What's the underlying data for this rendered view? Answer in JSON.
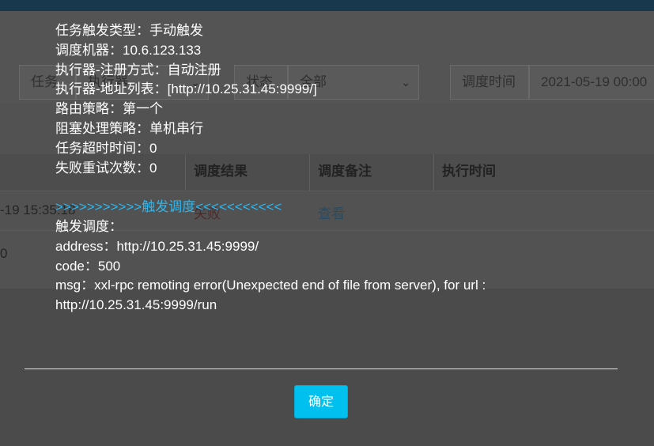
{
  "background": {
    "filters": {
      "task_label": "任务",
      "executor_value": "执行器",
      "status_label": "状态",
      "status_value": "全部",
      "time_label": "调度时间",
      "time_value": "2021-05-19 00:00"
    },
    "table": {
      "headers": [
        "调度结果",
        "调度备注",
        "执行时间"
      ],
      "row": {
        "time": "-19 15:35:18",
        "result": "失败",
        "remark_link": "查看"
      },
      "row2_fragment": "0"
    }
  },
  "dialog": {
    "lines": [
      "任务触发类型：手动触发",
      "调度机器：10.6.123.133",
      "执行器-注册方式：自动注册",
      "执行器-地址列表：[http://10.25.31.45:9999/]",
      "路由策略：第一个",
      "阻塞处理策略：单机串行",
      "任务超时时间：0",
      "失败重试次数：0"
    ],
    "separator": ">>>>>>>>>>>触发调度<<<<<<<<<<<",
    "trigger_lines": [
      "触发调度：",
      "address：http://10.25.31.45:9999/",
      "code：500",
      "msg：xxl-rpc remoting error(Unexpected end of file from server), for url : http://10.25.31.45:9999/run"
    ],
    "confirm_label": "确定"
  },
  "colors": {
    "accent": "#00c0ef",
    "separator": "#32b5ea",
    "overlay_text": "#ffffff"
  }
}
